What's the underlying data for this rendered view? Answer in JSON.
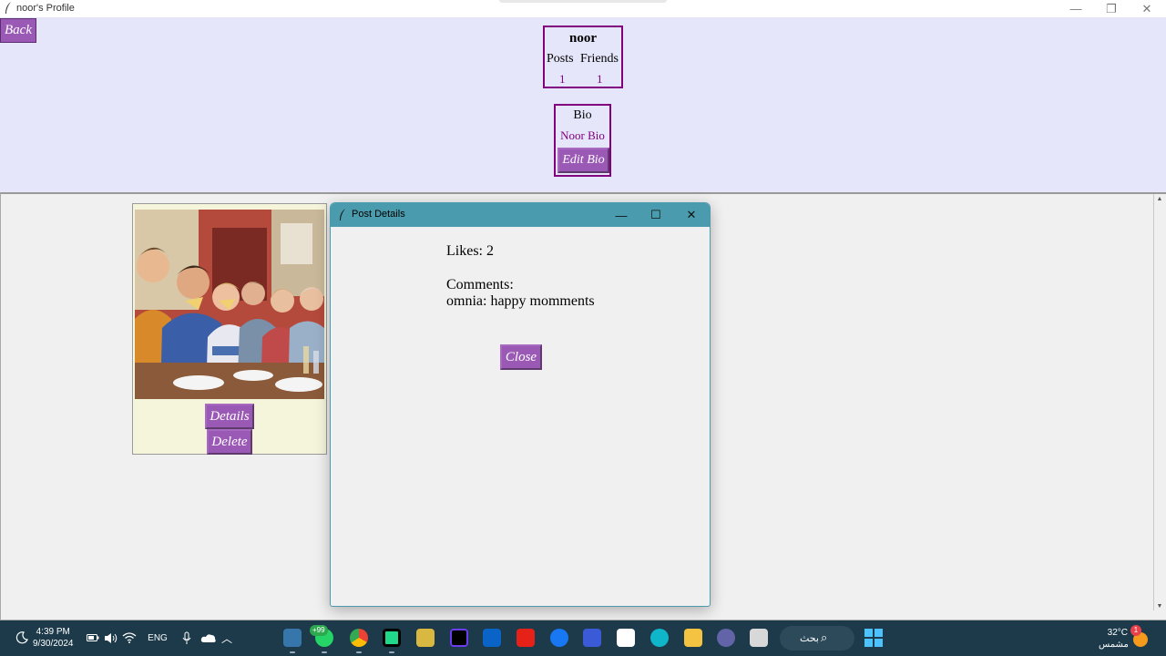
{
  "window": {
    "title": "noor's Profile",
    "controls": {
      "minimize": "—",
      "maximize": "❐",
      "close": "✕"
    }
  },
  "header": {
    "back_label": "Back",
    "username": "noor",
    "posts_label": "Posts",
    "friends_label": "Friends",
    "posts_count": "1",
    "friends_count": "1"
  },
  "bio": {
    "title": "Bio",
    "text": "Noor Bio",
    "edit_label": "Edit Bio"
  },
  "post": {
    "image_icon": "photo-family-eating-pizza",
    "details_label": "Details",
    "delete_label": "Delete"
  },
  "dialog": {
    "title": "Post Details",
    "likes": "Likes: 2",
    "comments_label": "Comments:",
    "comments": [
      "omnia: happy momments"
    ],
    "close_label": "Close",
    "controls": {
      "minimize": "—",
      "maximize": "☐",
      "close": "✕"
    }
  },
  "taskbar": {
    "time": "4:39 PM",
    "date": "9/30/2024",
    "language": "ENG",
    "notification_badge": "+99",
    "search_label": "بحث",
    "temperature": "32°C",
    "weather_text": "مشمس",
    "weather_badge": "1",
    "apps": [
      "python-idle",
      "whatsapp",
      "chrome",
      "pycharm",
      "tool",
      "intellij",
      "outlook",
      "youtube",
      "facebook",
      "app-blue",
      "store",
      "edge",
      "file-explorer",
      "teams",
      "window-copy"
    ]
  },
  "colors": {
    "button_purple": "#9b59b6",
    "accent_purple": "#800080",
    "profile_bg": "#e6e6fa",
    "post_bg": "#f5f5dc",
    "dialog_titlebar": "#4a9bad",
    "taskbar_bg": "#1c3a4a"
  }
}
